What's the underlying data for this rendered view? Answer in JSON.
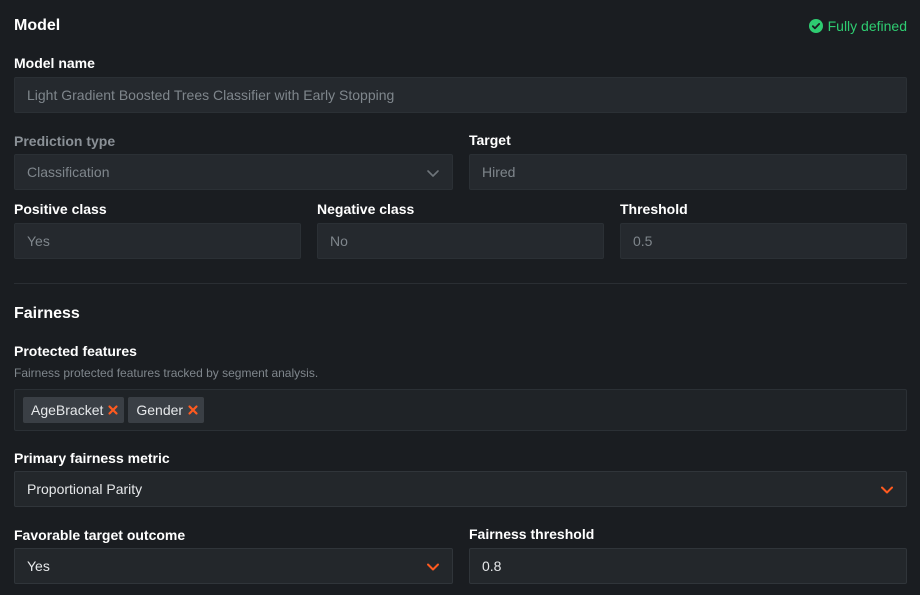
{
  "model": {
    "section_title": "Model",
    "status": {
      "text": "Fully defined",
      "icon": "check-circle-icon",
      "color": "#2ecc71"
    },
    "model_name": {
      "label": "Model name",
      "value": "Light Gradient Boosted Trees Classifier with Early Stopping"
    },
    "prediction_type": {
      "label": "Prediction type",
      "value": "Classification"
    },
    "target": {
      "label": "Target",
      "value": "Hired"
    },
    "positive_class": {
      "label": "Positive class",
      "value": "Yes"
    },
    "negative_class": {
      "label": "Negative class",
      "value": "No"
    },
    "threshold": {
      "label": "Threshold",
      "value": "0.5"
    }
  },
  "fairness": {
    "section_title": "Fairness",
    "protected_features": {
      "label": "Protected features",
      "hint": "Fairness protected features tracked by segment analysis.",
      "tags": [
        {
          "label": "AgeBracket"
        },
        {
          "label": "Gender"
        }
      ]
    },
    "primary_metric": {
      "label": "Primary fairness metric",
      "value": "Proportional Parity"
    },
    "favorable_outcome": {
      "label": "Favorable target outcome",
      "value": "Yes"
    },
    "fairness_threshold": {
      "label": "Fairness threshold",
      "value": "0.8"
    }
  },
  "colors": {
    "accent": "#ff5a1f",
    "success": "#2ecc71",
    "background": "#1a1d21"
  }
}
